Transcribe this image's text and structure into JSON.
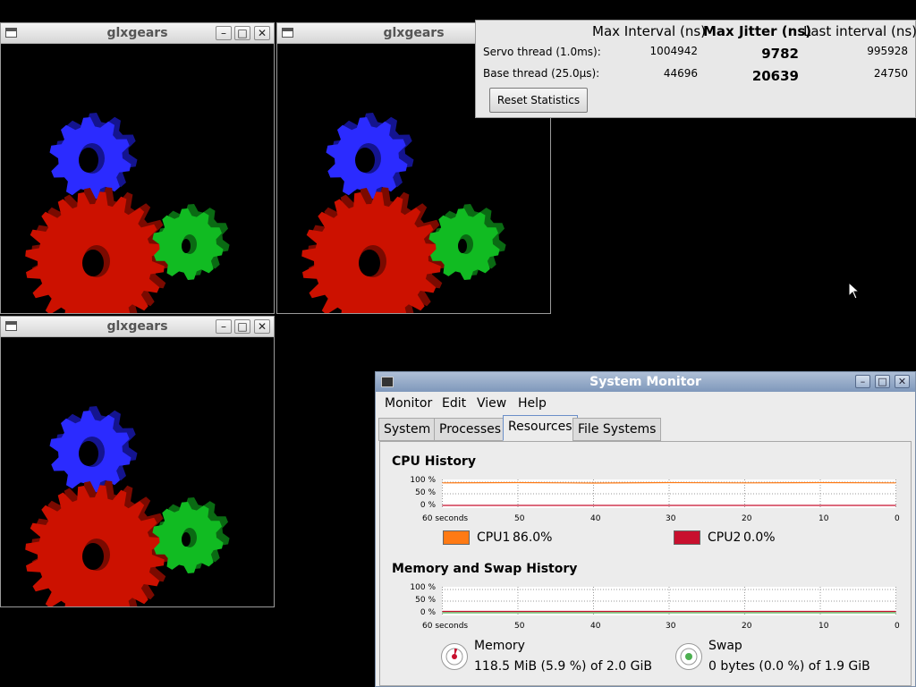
{
  "windows": {
    "gears1": {
      "title": "glxgears"
    },
    "gears2": {
      "title": "glxgears"
    },
    "gears3": {
      "title": "glxgears"
    },
    "controls": {
      "minimize": "–",
      "maximize": "□",
      "close": "✕"
    }
  },
  "latency": {
    "headers": {
      "max_interval": "Max Interval (ns)",
      "max_jitter": "Max Jitter (ns)",
      "last_interval": "Last interval (ns)"
    },
    "rows": [
      {
        "label": "Servo thread (1.0ms):",
        "max_interval": "1004942",
        "max_jitter": "9782",
        "last_interval": "995928"
      },
      {
        "label": "Base thread (25.0µs):",
        "max_interval": "44696",
        "max_jitter": "20639",
        "last_interval": "24750"
      }
    ],
    "reset_label": "Reset Statistics"
  },
  "system_monitor": {
    "title": "System Monitor",
    "menu": [
      "Monitor",
      "Edit",
      "View",
      "Help"
    ],
    "tabs": [
      "System",
      "Processes",
      "Resources",
      "File Systems"
    ],
    "active_tab": "Resources",
    "cpu": {
      "section": "CPU History",
      "y_ticks": [
        "100 %",
        "50 %",
        "0 %"
      ],
      "x_ticks": [
        "60 seconds",
        "50",
        "40",
        "30",
        "20",
        "10",
        "0"
      ],
      "legend": [
        {
          "label": "CPU1",
          "value": "86.0%",
          "color": "#ff7a14"
        },
        {
          "label": "CPU2",
          "value": "0.0%",
          "color": "#c8102e"
        }
      ]
    },
    "memory": {
      "section": "Memory and Swap History",
      "y_ticks": [
        "100 %",
        "50 %",
        "0 %"
      ],
      "x_ticks": [
        "60 seconds",
        "50",
        "40",
        "30",
        "20",
        "10",
        "0"
      ],
      "items": [
        {
          "label": "Memory",
          "value": "118.5 MiB (5.9 %) of 2.0 GiB",
          "color": "#c8102e",
          "fraction": 0.059
        },
        {
          "label": "Swap",
          "value": "0 bytes (0.0 %) of 1.9 GiB",
          "color": "#4caf50",
          "fraction": 0.0
        }
      ]
    }
  },
  "chart_data": [
    {
      "type": "line",
      "title": "CPU History",
      "x": [
        60,
        50,
        40,
        30,
        20,
        10,
        0
      ],
      "series": [
        {
          "name": "CPU1",
          "values": [
            97,
            98,
            96,
            98,
            97,
            98,
            97
          ]
        },
        {
          "name": "CPU2",
          "values": [
            0,
            0,
            0,
            0,
            0,
            0,
            0
          ]
        }
      ],
      "ylim": [
        0,
        100
      ]
    },
    {
      "type": "line",
      "title": "Memory and Swap History",
      "x": [
        60,
        50,
        40,
        30,
        20,
        10,
        0
      ],
      "series": [
        {
          "name": "Memory",
          "values": [
            5.9,
            5.9,
            5.9,
            5.9,
            5.9,
            5.9,
            5.9
          ]
        },
        {
          "name": "Swap",
          "values": [
            0,
            0,
            0,
            0,
            0,
            0,
            0
          ]
        }
      ],
      "ylim": [
        0,
        100
      ]
    }
  ]
}
